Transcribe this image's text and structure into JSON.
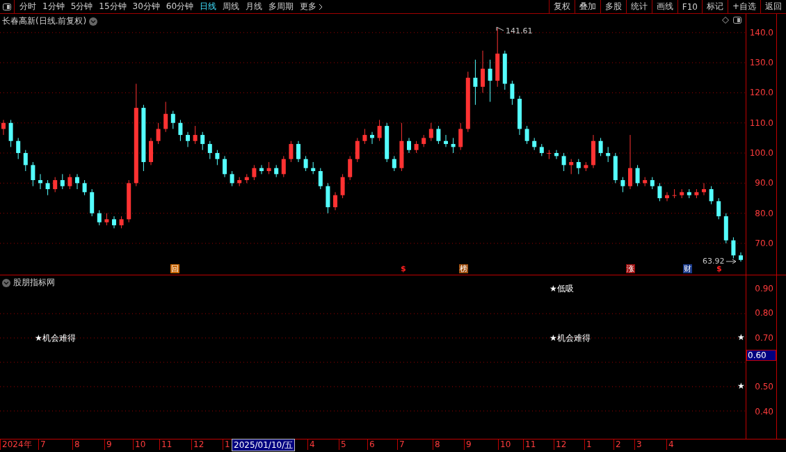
{
  "toolbar": {
    "periods": [
      {
        "label": "分时",
        "selected": false
      },
      {
        "label": "1分钟",
        "selected": false
      },
      {
        "label": "5分钟",
        "selected": false
      },
      {
        "label": "15分钟",
        "selected": false
      },
      {
        "label": "30分钟",
        "selected": false
      },
      {
        "label": "60分钟",
        "selected": false
      },
      {
        "label": "日线",
        "selected": true
      },
      {
        "label": "周线",
        "selected": false
      },
      {
        "label": "月线",
        "selected": false
      },
      {
        "label": "多周期",
        "selected": false
      }
    ],
    "more": "更多",
    "buttons": [
      "复权",
      "叠加",
      "多股",
      "统计",
      "画线",
      "F10",
      "标记",
      "+自选",
      "返回"
    ]
  },
  "chart": {
    "title": "长春高新(日线.前复权)",
    "high_label": "141.61",
    "low_label": "63.92",
    "chart_data": {
      "type": "candlestick",
      "grid": true,
      "ylim": [
        5.33,
        146.2
      ],
      "yticks": [
        {
          "value": 140,
          "label": "140.0"
        },
        {
          "value": 130,
          "label": "130.0"
        },
        {
          "value": 120,
          "label": "120.0"
        },
        {
          "value": 110,
          "label": "110.0"
        },
        {
          "value": 100,
          "label": "100.0"
        },
        {
          "value": 90,
          "label": "90.0"
        },
        {
          "value": 80,
          "label": "80.0"
        },
        {
          "value": 70,
          "label": "70.0"
        }
      ],
      "ohlc": [
        [
          108,
          111,
          106,
          110
        ],
        [
          110,
          111,
          102,
          104
        ],
        [
          104,
          105,
          98,
          100
        ],
        [
          100,
          101,
          94,
          96
        ],
        [
          96,
          97,
          89,
          91
        ],
        [
          91,
          93,
          88,
          90
        ],
        [
          90,
          91,
          86,
          88
        ],
        [
          88,
          92,
          87,
          91
        ],
        [
          91,
          93,
          88,
          89
        ],
        [
          89,
          93,
          88,
          92
        ],
        [
          92,
          93,
          88,
          90
        ],
        [
          90,
          91,
          86,
          87
        ],
        [
          87,
          88,
          79,
          80
        ],
        [
          80,
          81,
          76,
          77
        ],
        [
          77,
          80,
          76,
          78
        ],
        [
          78,
          79,
          75,
          76
        ],
        [
          76,
          79,
          75,
          78
        ],
        [
          78,
          91,
          77,
          90
        ],
        [
          90,
          123,
          89,
          115
        ],
        [
          115,
          116,
          94,
          97
        ],
        [
          97,
          105,
          96,
          104
        ],
        [
          104,
          110,
          103,
          108
        ],
        [
          108,
          117,
          107,
          113
        ],
        [
          113,
          114,
          108,
          110
        ],
        [
          110,
          111,
          104,
          106
        ],
        [
          106,
          107,
          102,
          104
        ],
        [
          104,
          109,
          103,
          106
        ],
        [
          106,
          107,
          101,
          103
        ],
        [
          103,
          104,
          98,
          100
        ],
        [
          100,
          101,
          96,
          98
        ],
        [
          98,
          99,
          92,
          93
        ],
        [
          93,
          94,
          89,
          90
        ],
        [
          90,
          92,
          89,
          91
        ],
        [
          91,
          93,
          90,
          92
        ],
        [
          92,
          96,
          91,
          95
        ],
        [
          95,
          96,
          93,
          94
        ],
        [
          94,
          97,
          93,
          95
        ],
        [
          95,
          96,
          92,
          93
        ],
        [
          93,
          99,
          92,
          98
        ],
        [
          98,
          104,
          97,
          103
        ],
        [
          103,
          104,
          97,
          98
        ],
        [
          98,
          99,
          94,
          95
        ],
        [
          95,
          97,
          93,
          94
        ],
        [
          94,
          95,
          88,
          89
        ],
        [
          89,
          90,
          80,
          82
        ],
        [
          82,
          87,
          81,
          86
        ],
        [
          86,
          93,
          85,
          92
        ],
        [
          92,
          99,
          91,
          98
        ],
        [
          98,
          105,
          97,
          104
        ],
        [
          104,
          108,
          103,
          106
        ],
        [
          106,
          107,
          103,
          105
        ],
        [
          105,
          111,
          104,
          109
        ],
        [
          109,
          110,
          97,
          98
        ],
        [
          98,
          99,
          94,
          95
        ],
        [
          95,
          110,
          94,
          104
        ],
        [
          104,
          105,
          100,
          101
        ],
        [
          101,
          104,
          100,
          103
        ],
        [
          103,
          106,
          102,
          105
        ],
        [
          105,
          110,
          104,
          108
        ],
        [
          108,
          109,
          103,
          104
        ],
        [
          104,
          106,
          102,
          103
        ],
        [
          103,
          105,
          100,
          102
        ],
        [
          102,
          110,
          101,
          108
        ],
        [
          108,
          127,
          107,
          125
        ],
        [
          125,
          131,
          116,
          122
        ],
        [
          122,
          134,
          120,
          128
        ],
        [
          128,
          131,
          117,
          124
        ],
        [
          124,
          141.61,
          122,
          133
        ],
        [
          133,
          134,
          121,
          123
        ],
        [
          123,
          124,
          116,
          118
        ],
        [
          118,
          119,
          106,
          108
        ],
        [
          108,
          109,
          103,
          104
        ],
        [
          104,
          105,
          101,
          102
        ],
        [
          102,
          103,
          99,
          100
        ],
        [
          100,
          101,
          98,
          100
        ],
        [
          100,
          101,
          98,
          99
        ],
        [
          99,
          100,
          94,
          96
        ],
        [
          96,
          98,
          93,
          97
        ],
        [
          97,
          98,
          93,
          95
        ],
        [
          95,
          97,
          94,
          96
        ],
        [
          96,
          106,
          95,
          104
        ],
        [
          104,
          105,
          99,
          100
        ],
        [
          100,
          102,
          97,
          99
        ],
        [
          99,
          100,
          90,
          91
        ],
        [
          91,
          92,
          87,
          89
        ],
        [
          89,
          106,
          88,
          95
        ],
        [
          95,
          96,
          89,
          90
        ],
        [
          90,
          92,
          89,
          91
        ],
        [
          91,
          92,
          88,
          89
        ],
        [
          89,
          90,
          84,
          85
        ],
        [
          85,
          87,
          84,
          86
        ],
        [
          86,
          88,
          85,
          86
        ],
        [
          86,
          88,
          85,
          87
        ],
        [
          87,
          88,
          85,
          86
        ],
        [
          86,
          88,
          85,
          87
        ],
        [
          87,
          90,
          86,
          88
        ],
        [
          88,
          89,
          83,
          84
        ],
        [
          84,
          85,
          78,
          79
        ],
        [
          79,
          80,
          70,
          71
        ],
        [
          71,
          72,
          65,
          66
        ],
        [
          66,
          67,
          63.92,
          64.5
        ]
      ]
    },
    "markers": [
      {
        "text": "回",
        "color": "#c86400"
      },
      {
        "text": "$",
        "color": "#ff2020"
      },
      {
        "text": "榜",
        "color": "#a05010"
      },
      {
        "text": "涨",
        "color": "#a01010"
      },
      {
        "text": "财",
        "color": "#1a3a8a"
      },
      {
        "text": "$",
        "color": "#ff2020"
      }
    ]
  },
  "indicator": {
    "title": "股朋指标网",
    "ticks": [
      "0.90",
      "0.80",
      "0.70",
      "0.50",
      "0.40"
    ],
    "current_value": "0.60",
    "signals": [
      {
        "text": "★机会难得"
      },
      {
        "text": "★低吸"
      },
      {
        "text": "★机会难得"
      },
      {
        "text": "★"
      },
      {
        "text": "★"
      }
    ]
  },
  "date_axis": {
    "labels": [
      {
        "text": "2024年",
        "selected": false
      },
      {
        "text": "7",
        "selected": false
      },
      {
        "text": "8",
        "selected": false
      },
      {
        "text": "9",
        "selected": false
      },
      {
        "text": "10",
        "selected": false
      },
      {
        "text": "11",
        "selected": false
      },
      {
        "text": "12",
        "selected": false
      },
      {
        "text": "1",
        "selected": false
      },
      {
        "text": "2025/01/10/五",
        "selected": true
      },
      {
        "text": "4",
        "selected": false
      },
      {
        "text": "5",
        "selected": false
      },
      {
        "text": "6",
        "selected": false
      },
      {
        "text": "7",
        "selected": false
      },
      {
        "text": "8",
        "selected": false
      },
      {
        "text": "9",
        "selected": false
      },
      {
        "text": "10",
        "selected": false
      },
      {
        "text": "11",
        "selected": false
      },
      {
        "text": "12",
        "selected": false
      },
      {
        "text": "1",
        "selected": false
      },
      {
        "text": "2",
        "selected": false
      },
      {
        "text": "3",
        "selected": false
      },
      {
        "text": "4",
        "selected": false
      }
    ]
  }
}
